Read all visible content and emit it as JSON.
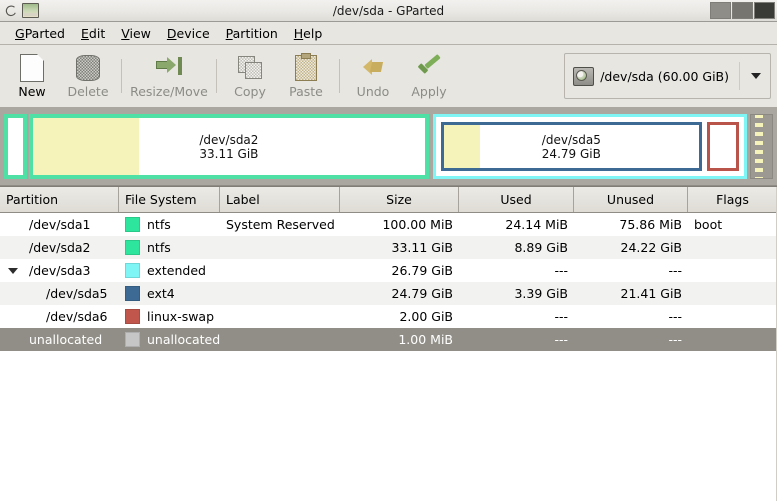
{
  "window": {
    "title": "/dev/sda - GParted",
    "app_icon": "gparted-icon",
    "controls": {
      "minimize": "minimize-button",
      "maximize": "maximize-button",
      "close": "close-button"
    }
  },
  "menubar": {
    "items": [
      {
        "label": "GParted",
        "mnemonic": "G"
      },
      {
        "label": "Edit",
        "mnemonic": "E"
      },
      {
        "label": "View",
        "mnemonic": "V"
      },
      {
        "label": "Device",
        "mnemonic": "D"
      },
      {
        "label": "Partition",
        "mnemonic": "P"
      },
      {
        "label": "Help",
        "mnemonic": "H"
      }
    ]
  },
  "toolbar": {
    "buttons": [
      {
        "label": "New",
        "icon": "new-document-icon",
        "enabled": true
      },
      {
        "label": "Delete",
        "icon": "delete-icon",
        "enabled": false
      },
      {
        "label": "Resize/Move",
        "icon": "resize-move-icon",
        "enabled": false
      },
      {
        "label": "Copy",
        "icon": "copy-icon",
        "enabled": false
      },
      {
        "label": "Paste",
        "icon": "paste-icon",
        "enabled": false
      },
      {
        "label": "Undo",
        "icon": "undo-icon",
        "enabled": false
      },
      {
        "label": "Apply",
        "icon": "apply-checkmark-icon",
        "enabled": false
      }
    ],
    "device_selector": {
      "icon": "harddisk-icon",
      "value": "/dev/sda  (60.00 GiB)",
      "arrow": "chevron-down-icon"
    }
  },
  "graphic": {
    "blocks": [
      {
        "name": "sda1-block",
        "label": "",
        "size": "",
        "border": "#2ee59d",
        "used_pct": 0,
        "flex": 16,
        "type": "partition"
      },
      {
        "name": "sda2-block",
        "label": "/dev/sda2",
        "size": "33.11 GiB",
        "border": "#4fe0a6",
        "used_pct": 27,
        "flex": 420,
        "type": "partition"
      },
      {
        "name": "sda3-extended-block",
        "label": "",
        "size": "",
        "border": "#7ff5f5",
        "used_pct": 0,
        "flex": 320,
        "type": "extended"
      },
      {
        "name": "unallocated-block",
        "label": "",
        "size": "",
        "border": "#8b8981",
        "used_pct": 0,
        "flex": 22,
        "type": "unallocated"
      }
    ],
    "extended_children": [
      {
        "name": "sda5-block",
        "label": "/dev/sda5",
        "size": "24.79 GiB",
        "border": "#3d6a94",
        "used_pct": 14,
        "flex": 86
      },
      {
        "name": "sda6-block",
        "label": "",
        "size": "",
        "border": "#b9544b",
        "used_pct": 0,
        "flex": 9
      }
    ]
  },
  "table": {
    "columns": [
      {
        "label": "Partition",
        "align": "left"
      },
      {
        "label": "File System",
        "align": "left"
      },
      {
        "label": "Label",
        "align": "left"
      },
      {
        "label": "Size",
        "align": "center"
      },
      {
        "label": "Used",
        "align": "center"
      },
      {
        "label": "Unused",
        "align": "center"
      },
      {
        "label": "Flags",
        "align": "center"
      }
    ],
    "rows": [
      {
        "partition": "/dev/sda1",
        "filesystem": "ntfs",
        "fs_color": "#2ee59d",
        "label": "System Reserved",
        "size": "100.00 MiB",
        "used": "24.14 MiB",
        "unused": "75.86 MiB",
        "flags": "boot",
        "indent": 0,
        "expander": false,
        "selected": false
      },
      {
        "partition": "/dev/sda2",
        "filesystem": "ntfs",
        "fs_color": "#2ee59d",
        "label": "",
        "size": "33.11 GiB",
        "used": "8.89 GiB",
        "unused": "24.22 GiB",
        "flags": "",
        "indent": 0,
        "expander": false,
        "selected": false
      },
      {
        "partition": "/dev/sda3",
        "filesystem": "extended",
        "fs_color": "#7ff5f5",
        "label": "",
        "size": "26.79 GiB",
        "used": "---",
        "unused": "---",
        "flags": "",
        "indent": 0,
        "expander": true,
        "selected": false
      },
      {
        "partition": "/dev/sda5",
        "filesystem": "ext4",
        "fs_color": "#3d6a94",
        "label": "",
        "size": "24.79 GiB",
        "used": "3.39 GiB",
        "unused": "21.41 GiB",
        "flags": "",
        "indent": 1,
        "expander": false,
        "selected": false
      },
      {
        "partition": "/dev/sda6",
        "filesystem": "linux-swap",
        "fs_color": "#c0564c",
        "label": "",
        "size": "2.00 GiB",
        "used": "---",
        "unused": "---",
        "flags": "",
        "indent": 1,
        "expander": false,
        "selected": false
      },
      {
        "partition": "unallocated",
        "filesystem": "unallocated",
        "fs_color": "#c6c6c6",
        "label": "",
        "size": "1.00 MiB",
        "used": "---",
        "unused": "---",
        "flags": "",
        "indent": 0,
        "expander": false,
        "selected": true
      }
    ]
  }
}
